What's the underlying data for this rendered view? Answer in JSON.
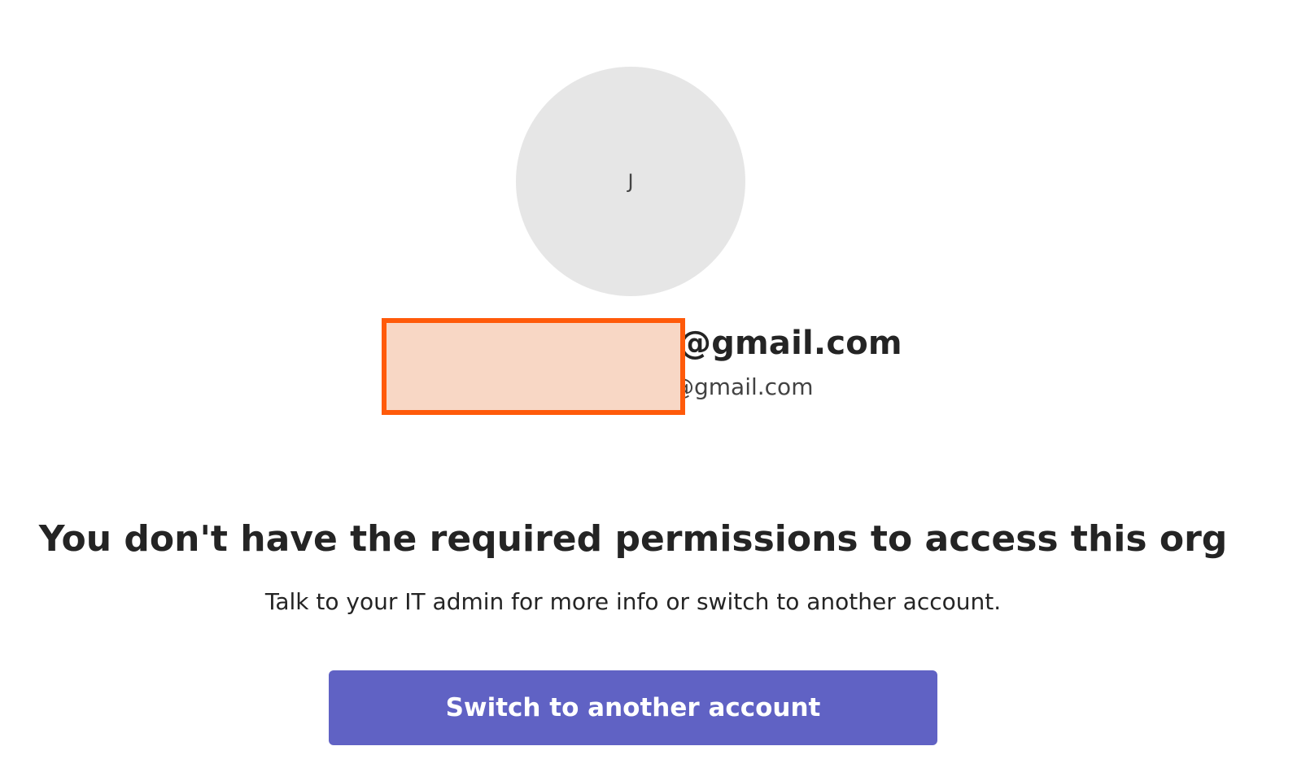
{
  "account": {
    "avatar_initial": "J",
    "email_primary": "@gmail.com",
    "email_secondary": "@gmail.com"
  },
  "message": {
    "headline": "You don't have the required permissions to access this org",
    "subtext": "Talk to your IT admin for more info or switch to another account."
  },
  "actions": {
    "switch_label": "Switch to another account"
  },
  "colors": {
    "accent": "#6062c4",
    "redaction_fill": "#f8d7c5",
    "redaction_border": "#ff5a0a",
    "avatar_bg": "#e6e6e6"
  }
}
